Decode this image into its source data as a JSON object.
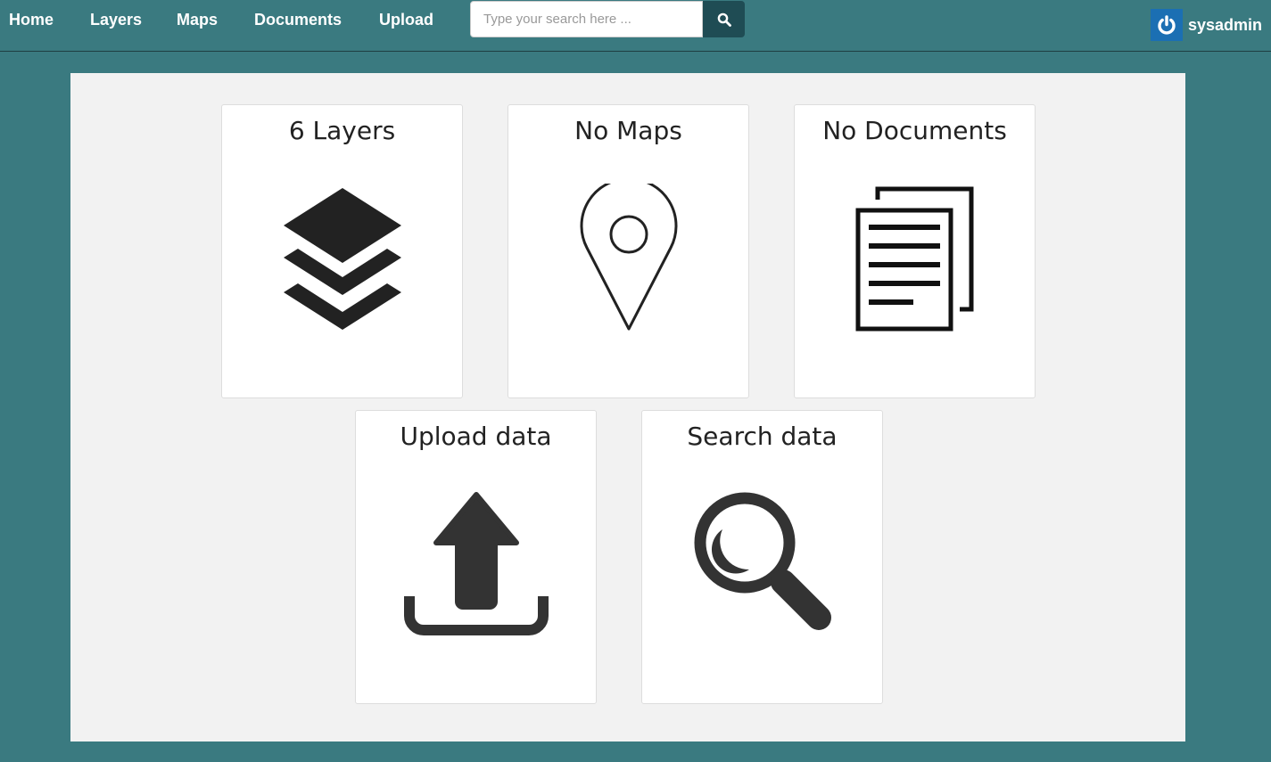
{
  "nav": {
    "items": [
      {
        "label": "Home"
      },
      {
        "label": "Layers"
      },
      {
        "label": "Maps"
      },
      {
        "label": "Documents"
      },
      {
        "label": "Upload"
      }
    ]
  },
  "search": {
    "placeholder": "Type your search here ...",
    "value": "",
    "button_icon": "search-icon"
  },
  "user": {
    "name": "sysadmin",
    "icon": "power-icon",
    "icon_bg": "#1b6fb3"
  },
  "colors": {
    "header_bg": "#3a7a80",
    "panel_bg": "#f2f2f2",
    "search_button_bg": "#1f4c54",
    "icon_color": "#222222"
  },
  "cards": [
    {
      "title": "6 Layers",
      "icon": "layers-icon"
    },
    {
      "title": "No Maps",
      "icon": "map-marker-icon"
    },
    {
      "title": "No Documents",
      "icon": "documents-icon"
    },
    {
      "title": "Upload data",
      "icon": "upload-icon"
    },
    {
      "title": "Search data",
      "icon": "magnifier-icon"
    }
  ]
}
